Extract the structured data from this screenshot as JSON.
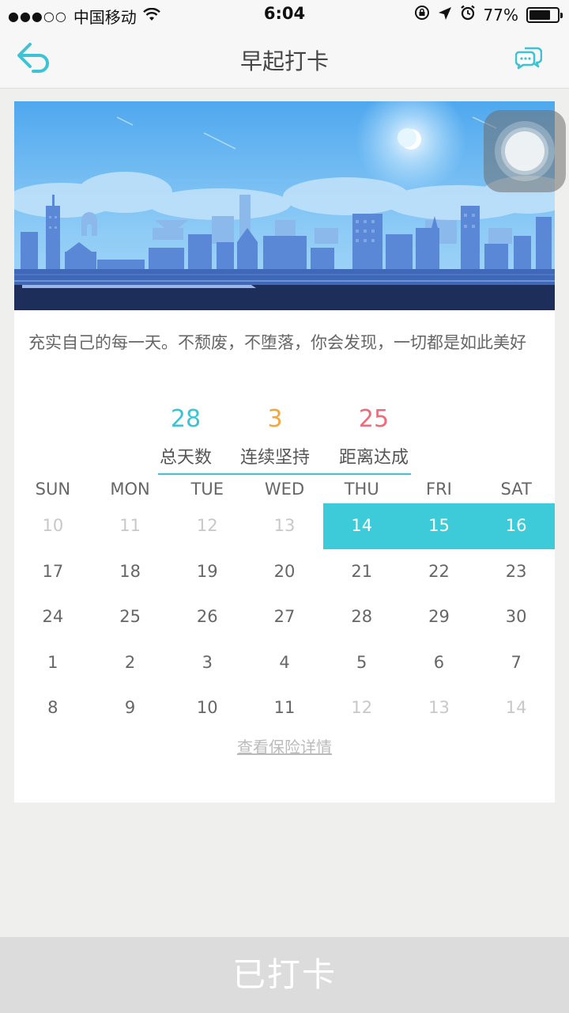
{
  "status_bar": {
    "signal": "●●●○○",
    "carrier": "中国移动",
    "time": "6:04",
    "battery": "77%",
    "battery_level": 0.77
  },
  "nav": {
    "title": "早起打卡",
    "accent": "#3ec3d5"
  },
  "motto": "充实自己的每一天。不颓废，不堕落，你会发现，一切都是如此美好",
  "stats": [
    {
      "value": "28",
      "label": "总天数",
      "color": "#3ec3d5"
    },
    {
      "value": "3",
      "label": "连续坚持",
      "color": "#f2a640"
    },
    {
      "value": "25",
      "label": "距离达成",
      "color": "#ee6b7a"
    }
  ],
  "calendar": {
    "weekdays": [
      "SUN",
      "MON",
      "TUE",
      "WED",
      "THU",
      "FRI",
      "SAT"
    ],
    "weeks": [
      [
        {
          "d": "10",
          "dim": true
        },
        {
          "d": "11",
          "dim": true
        },
        {
          "d": "12",
          "dim": true
        },
        {
          "d": "13",
          "dim": true
        },
        {
          "d": "14",
          "checked": true
        },
        {
          "d": "15",
          "checked": true
        },
        {
          "d": "16",
          "checked": true
        }
      ],
      [
        {
          "d": "17"
        },
        {
          "d": "18"
        },
        {
          "d": "19"
        },
        {
          "d": "20"
        },
        {
          "d": "21"
        },
        {
          "d": "22"
        },
        {
          "d": "23"
        }
      ],
      [
        {
          "d": "24"
        },
        {
          "d": "25"
        },
        {
          "d": "26"
        },
        {
          "d": "27"
        },
        {
          "d": "28"
        },
        {
          "d": "29"
        },
        {
          "d": "30"
        }
      ],
      [
        {
          "d": "1"
        },
        {
          "d": "2"
        },
        {
          "d": "3"
        },
        {
          "d": "4"
        },
        {
          "d": "5"
        },
        {
          "d": "6"
        },
        {
          "d": "7"
        }
      ],
      [
        {
          "d": "8"
        },
        {
          "d": "9"
        },
        {
          "d": "10"
        },
        {
          "d": "11"
        },
        {
          "d": "12",
          "dim": true
        },
        {
          "d": "13",
          "dim": true
        },
        {
          "d": "14",
          "dim": true
        }
      ]
    ],
    "checked_color": "#3ecbd9"
  },
  "insurance_link": "查看保险详情",
  "checkin_button": "已打卡",
  "icons": {
    "back": "back-arrow-icon",
    "chat": "chat-bubbles-icon",
    "wifi": "wifi-icon",
    "lock": "rotation-lock-icon",
    "location": "location-arrow-icon",
    "alarm": "alarm-icon"
  }
}
